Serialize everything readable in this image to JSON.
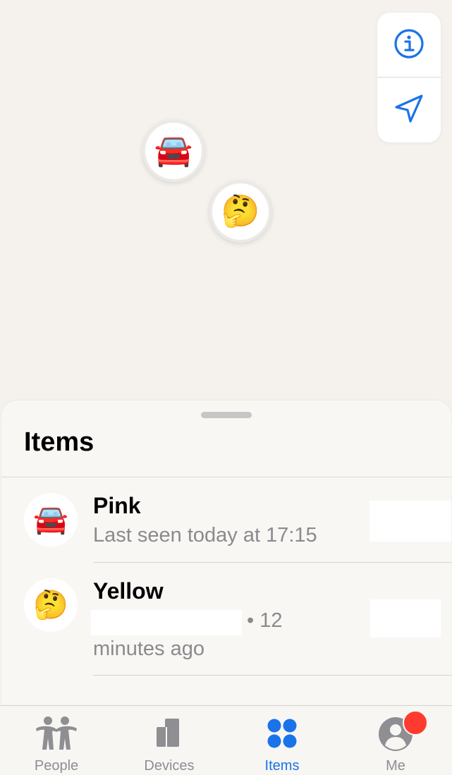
{
  "map": {
    "controls": {
      "info_icon": "info-icon",
      "location_icon": "location-arrow-icon"
    },
    "pins": [
      {
        "emoji": "🚘",
        "name": "Pink"
      },
      {
        "emoji": "🤔",
        "name": "Yellow"
      }
    ]
  },
  "sheet": {
    "title": "Items",
    "items": [
      {
        "emoji": "🚘",
        "name": "Pink",
        "status": "Last seen today at 17:15"
      },
      {
        "emoji": "🤔",
        "name": "Yellow",
        "status_suffix": "• 12",
        "status_line2": "minutes ago"
      }
    ]
  },
  "tabbar": {
    "active_color": "#1a73e8",
    "inactive_color": "#8e8e93",
    "badge_color": "#ff3b30",
    "tabs": [
      {
        "label": "People",
        "icon": "people-icon"
      },
      {
        "label": "Devices",
        "icon": "devices-icon"
      },
      {
        "label": "Items",
        "icon": "items-icon",
        "active": true
      },
      {
        "label": "Me",
        "icon": "me-icon",
        "badge": true
      }
    ]
  }
}
